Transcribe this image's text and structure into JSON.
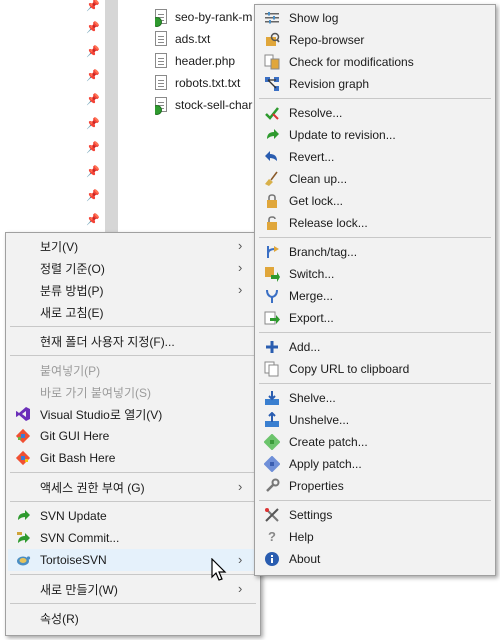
{
  "explorer": {
    "files": [
      {
        "name": "seo-by-rank-m",
        "svn": true
      },
      {
        "name": "ads.txt",
        "svn": false
      },
      {
        "name": "header.php",
        "svn": false
      },
      {
        "name": "robots.txt.txt",
        "svn": false
      },
      {
        "name": "stock-sell-char",
        "svn": true
      }
    ]
  },
  "left_menu": {
    "view": "보기(V)",
    "sort": "정렬 기준(O)",
    "group": "분류 방법(P)",
    "refresh": "새로 고침(E)",
    "customize": "현재 폴더 사용자 지정(F)...",
    "paste": "붙여넣기(P)",
    "paste_shortcut": "바로 가기 붙여넣기(S)",
    "visual_studio": "Visual Studio로 열기(V)",
    "git_gui": "Git GUI Here",
    "git_bash": "Git Bash Here",
    "give_access": "액세스 권한 부여 (G)",
    "svn_update": "SVN Update",
    "svn_commit": "SVN Commit...",
    "tortoise": "TortoiseSVN",
    "new": "새로 만들기(W)",
    "properties": "속성(R)"
  },
  "right_menu": {
    "show_log": "Show log",
    "repo_browser": "Repo-browser",
    "check_mods": "Check for modifications",
    "revision_graph": "Revision graph",
    "resolve": "Resolve...",
    "update_to_rev": "Update to revision...",
    "revert": "Revert...",
    "clean_up": "Clean up...",
    "get_lock": "Get lock...",
    "release_lock": "Release lock...",
    "branch_tag": "Branch/tag...",
    "switch": "Switch...",
    "merge": "Merge...",
    "export": "Export...",
    "add": "Add...",
    "copy_url": "Copy URL to clipboard",
    "shelve": "Shelve...",
    "unshelve": "Unshelve...",
    "create_patch": "Create patch...",
    "apply_patch": "Apply patch...",
    "properties": "Properties",
    "settings": "Settings",
    "help": "Help",
    "about": "About"
  },
  "colors": {
    "menu_bg": "#f2f2f2",
    "highlight": "#e5f1fb",
    "disabled_text": "#9b9b9b",
    "separator": "#c8c8c8"
  }
}
